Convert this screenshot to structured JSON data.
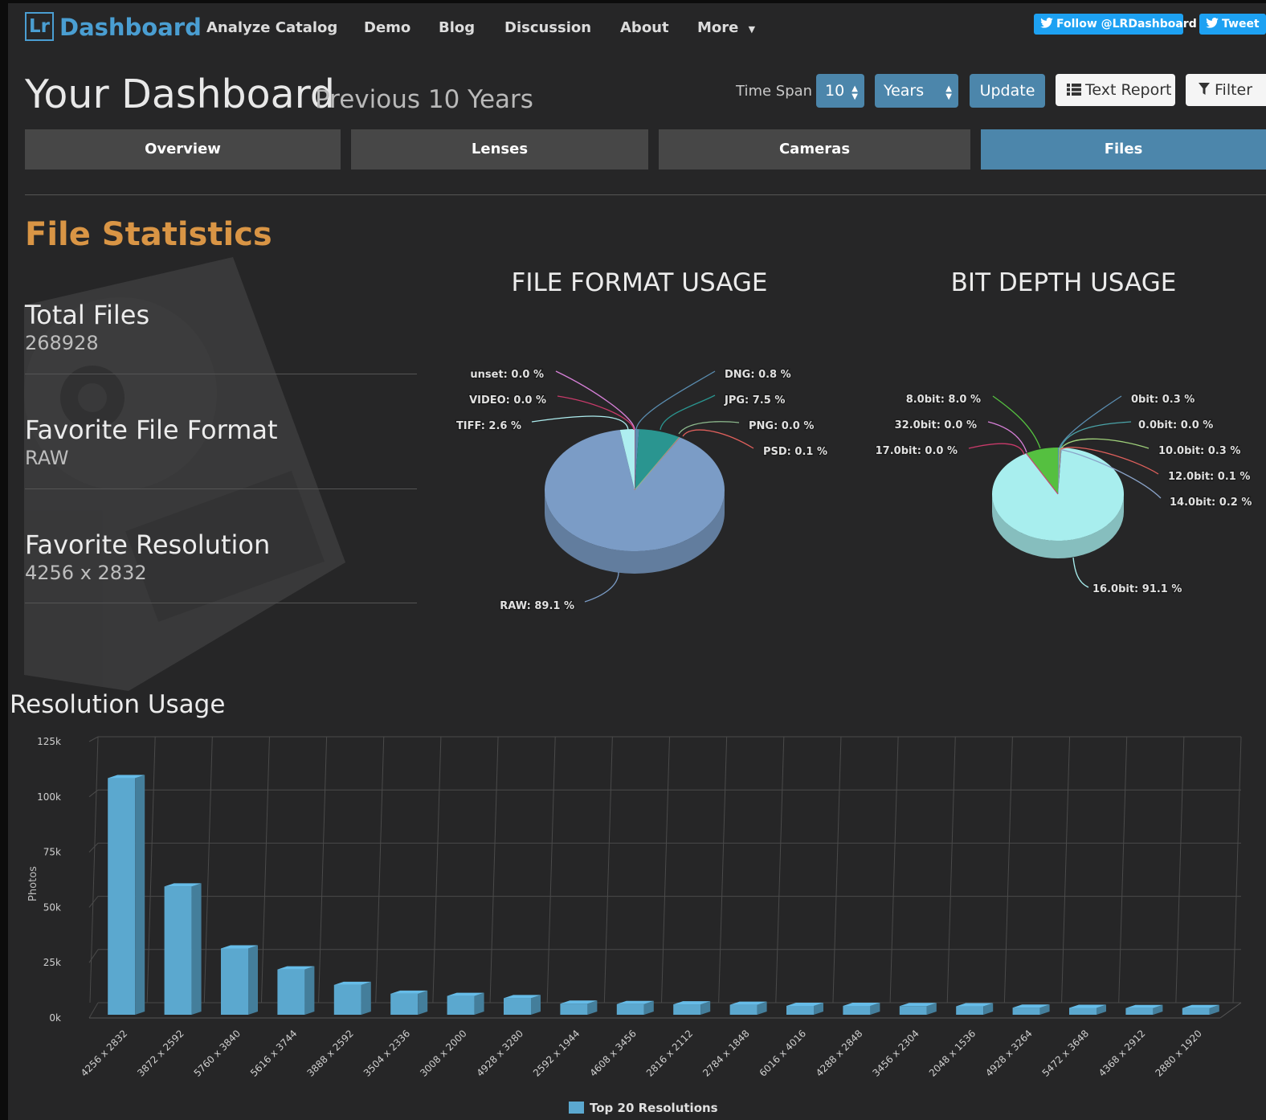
{
  "navbar": {
    "logo_mark": "Lr",
    "logo_text": "Dashboard",
    "items": [
      "Analyze Catalog",
      "Demo",
      "Blog",
      "Discussion",
      "About",
      "More"
    ],
    "follow_label": "Follow @LRDashboard",
    "tweet_label": "Tweet"
  },
  "header": {
    "title": "Your Dashboard",
    "subtitle": "Previous 10 Years",
    "timespan_label": "Time Span",
    "timespan_value": "10",
    "unit_value": "Years",
    "update_label": "Update",
    "text_report_label": "Text Report",
    "filter_label": "Filter"
  },
  "tabs": [
    "Overview",
    "Lenses",
    "Cameras",
    "Files"
  ],
  "active_tab": "Files",
  "section_title": "File Statistics",
  "stats": [
    {
      "label": "Total Files",
      "value": "268928"
    },
    {
      "label": "Favorite File Format",
      "value": "RAW"
    },
    {
      "label": "Favorite Resolution",
      "value": "4256 x 2832"
    }
  ],
  "colors": {
    "accent": "#4c86ab",
    "section_title": "#d99545",
    "bar": "#5ba8cf"
  },
  "chart_data": [
    {
      "type": "pie",
      "title": "FILE FORMAT USAGE",
      "slices": [
        {
          "label": "RAW: 89.1 %",
          "name": "RAW",
          "value": 89.1,
          "color": "#7b9cc6"
        },
        {
          "label": "DNG: 0.8 %",
          "name": "DNG",
          "value": 0.8,
          "color": "#5a8db0"
        },
        {
          "label": "JPG: 7.5 %",
          "name": "JPG",
          "value": 7.5,
          "color": "#2a9590"
        },
        {
          "label": "PNG: 0.0 %",
          "name": "PNG",
          "value": 0.0,
          "color": "#8fbc8f"
        },
        {
          "label": "PSD: 0.1 %",
          "name": "PSD",
          "value": 0.1,
          "color": "#e0605c"
        },
        {
          "label": "unset: 0.0 %",
          "name": "unset",
          "value": 0.0,
          "color": "#d780d8"
        },
        {
          "label": "VIDEO: 0.0 %",
          "name": "VIDEO",
          "value": 0.0,
          "color": "#c83a6a"
        },
        {
          "label": "TIFF: 2.6 %",
          "name": "TIFF",
          "value": 2.6,
          "color": "#aeeef0"
        }
      ]
    },
    {
      "type": "pie",
      "title": "BIT DEPTH USAGE",
      "slices": [
        {
          "label": "16.0bit: 91.1 %",
          "name": "16.0bit",
          "value": 91.1,
          "color": "#a8eeee"
        },
        {
          "label": "0bit: 0.3 %",
          "name": "0bit",
          "value": 0.3,
          "color": "#5a8db0"
        },
        {
          "label": "0.0bit: 0.0 %",
          "name": "0.0bit",
          "value": 0.0,
          "color": "#4aa3a8"
        },
        {
          "label": "10.0bit: 0.3 %",
          "name": "10.0bit",
          "value": 0.3,
          "color": "#9fd07a"
        },
        {
          "label": "12.0bit: 0.1 %",
          "name": "12.0bit",
          "value": 0.1,
          "color": "#e0605c"
        },
        {
          "label": "14.0bit: 0.2 %",
          "name": "14.0bit",
          "value": 0.2,
          "color": "#8aa3c8"
        },
        {
          "label": "8.0bit: 8.0 %",
          "name": "8.0bit",
          "value": 8.0,
          "color": "#55c040"
        },
        {
          "label": "32.0bit: 0.0 %",
          "name": "32.0bit",
          "value": 0.0,
          "color": "#d780d8"
        },
        {
          "label": "17.0bit: 0.0 %",
          "name": "17.0bit",
          "value": 0.0,
          "color": "#c83a6a"
        }
      ]
    },
    {
      "type": "bar",
      "title": "Resolution Usage",
      "ylabel": "Photos",
      "ylim": [
        0,
        125000
      ],
      "yticks": [
        "0k",
        "25k",
        "50k",
        "75k",
        "100k",
        "125k"
      ],
      "grid": true,
      "legend": "bottom-center",
      "categories": [
        "4256 x 2832",
        "3872 x 2592",
        "5760 x 3840",
        "5616 x 3744",
        "3888 x 2592",
        "3504 x 2336",
        "3008 x 2000",
        "4928 x 3280",
        "2592 x 1944",
        "4608 x 3456",
        "2816 x 2112",
        "2784 x 1848",
        "6016 x 4016",
        "4288 x 2848",
        "3456 x 2304",
        "2048 x 1536",
        "4928 x 3264",
        "5472 x 3648",
        "4368 x 2912",
        "2880 x 1920"
      ],
      "series": [
        {
          "name": "Top 20 Resolutions",
          "values": [
            107000,
            58000,
            30000,
            20500,
            13500,
            9500,
            8500,
            7500,
            5000,
            4800,
            4700,
            4500,
            4000,
            4000,
            3900,
            3800,
            3200,
            3100,
            3000,
            3000
          ]
        }
      ]
    }
  ]
}
